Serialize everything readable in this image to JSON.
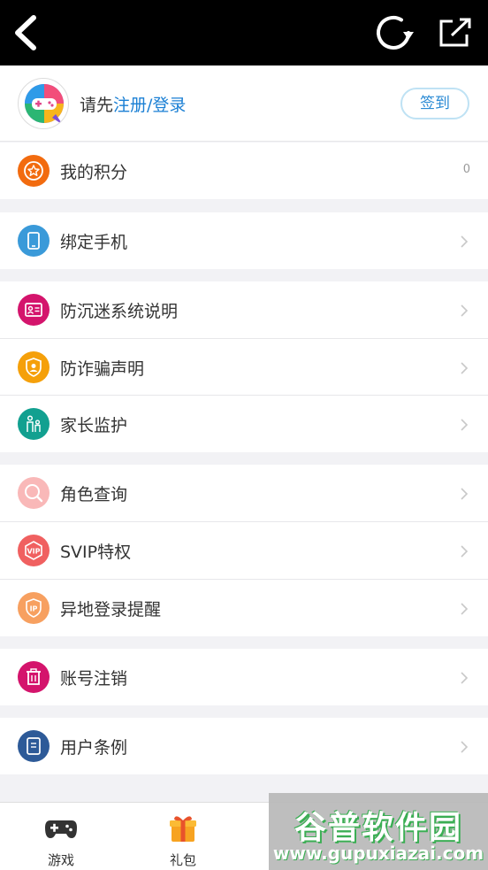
{
  "topbar": {
    "back_icon": "chevron-left-icon",
    "refresh_icon": "refresh-icon",
    "share_icon": "external-share-icon"
  },
  "profile": {
    "prompt_prefix": "请先",
    "prompt_link": "注册/登录",
    "signin_label": "签到",
    "accent_color": "#1a7fd4"
  },
  "points": {
    "label": "我的积分",
    "value": "0",
    "icon": "star-icon",
    "color": "#f26b0f"
  },
  "menu": {
    "bind_phone": {
      "label": "绑定手机",
      "icon": "phone-icon",
      "color": "#3a9ad9"
    },
    "anti_addiction": {
      "label": "防沉迷系统说明",
      "icon": "id-card-icon",
      "color": "#d4146c"
    },
    "anti_fraud": {
      "label": "防诈骗声明",
      "icon": "shield-user-icon",
      "color": "#f5a00a"
    },
    "parental": {
      "label": "家长监护",
      "icon": "family-icon",
      "color": "#12a090"
    },
    "role_query": {
      "label": "角色查询",
      "icon": "magnifier-icon",
      "color": "#f9b8b8"
    },
    "svip": {
      "label": "SVIP特权",
      "icon": "vip-badge-icon",
      "color": "#f06060"
    },
    "remote_login": {
      "label": "异地登录提醒",
      "icon": "ip-shield-icon",
      "color": "#f7a060"
    },
    "account_cancel": {
      "label": "账号注销",
      "icon": "trash-icon",
      "color": "#d4146c"
    },
    "user_terms": {
      "label": "用户条例",
      "icon": "document-icon",
      "color": "#2d5a98"
    }
  },
  "tabbar": {
    "games": {
      "label": "游戏",
      "icon": "gamepad-icon"
    },
    "gifts": {
      "label": "礼包",
      "icon": "gift-icon"
    },
    "tab3": {
      "label": ""
    },
    "tab4": {
      "label": ""
    }
  },
  "watermark": {
    "title": "谷普软件园",
    "url": "www.gupuxiazai.com"
  }
}
